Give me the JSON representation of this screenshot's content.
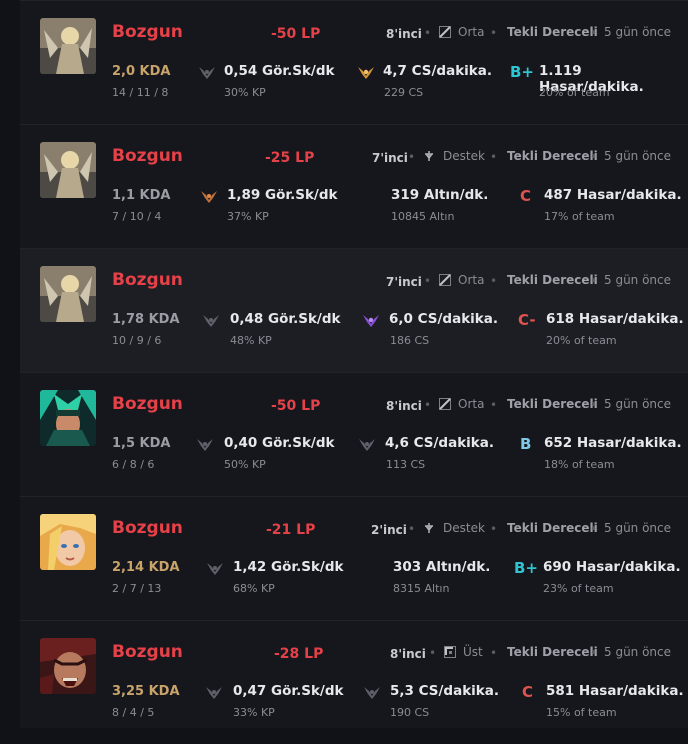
{
  "matches": [
    {
      "result": "Bozgun",
      "lp": "-50 LP",
      "rank": "8'inci",
      "position": "Orta",
      "queue": "Tekli Dereceli",
      "ago": "5 gün önce",
      "kda": "2,0 KDA",
      "kda_detail": "14 / 11 / 8",
      "vision": "0,54 Gör.Sk/dk",
      "kp": "30% KP",
      "farm": "4,7 CS/dakika.",
      "farm_sub": "229 CS",
      "grade": "B+",
      "damage": "1.119 Hasar/dakika.",
      "team_share": "20% of team",
      "kda_color": "#c8a36a",
      "grade_color": "#2fc4d0",
      "champion": "kayle-icon",
      "ward": "gold-ward-icon"
    },
    {
      "result": "Bozgun",
      "lp": "-25 LP",
      "rank": "7'inci",
      "position": "Destek",
      "queue": "Tekli Dereceli",
      "ago": "5 gün önce",
      "kda": "1,1 KDA",
      "kda_detail": "7 / 10 / 4",
      "vision": "1,89 Gör.Sk/dk",
      "kp": "37% KP",
      "farm": "319 Altın/dk.",
      "farm_sub": "10845 Altın",
      "grade": "C",
      "damage": "487 Hasar/dakika.",
      "team_share": "17% of team",
      "kda_color": "#9b9ca4",
      "grade_color": "#e0544f",
      "champion": "kayle-icon",
      "ward": "orange-ward-icon"
    },
    {
      "result": "Bozgun",
      "lp": "",
      "rank": "7'inci",
      "position": "Orta",
      "queue": "Tekli Dereceli",
      "ago": "5 gün önce",
      "kda": "1,78 KDA",
      "kda_detail": "10 / 9 / 6",
      "vision": "0,48 Gör.Sk/dk",
      "kp": "48% KP",
      "farm": "6,0 CS/dakika.",
      "farm_sub": "186 CS",
      "grade": "C-",
      "damage": "618 Hasar/dakika.",
      "team_share": "20% of team",
      "kda_color": "#9b9ca4",
      "grade_color": "#e0544f",
      "champion": "kayle-icon",
      "ward": "purple-ward-icon"
    },
    {
      "result": "Bozgun",
      "lp": "-50 LP",
      "rank": "8'inci",
      "position": "Orta",
      "queue": "Tekli Dereceli",
      "ago": "5 gün önce",
      "kda": "1,5 KDA",
      "kda_detail": "6 / 8 / 6",
      "vision": "0,40 Gör.Sk/dk",
      "kp": "50% KP",
      "farm": "4,6 CS/dakika.",
      "farm_sub": "113 CS",
      "grade": "B",
      "damage": "652 Hasar/dakika.",
      "team_share": "18% of team",
      "kda_color": "#9b9ca4",
      "grade_color": "#7fc8e8",
      "champion": "karma-icon",
      "ward": "gray-ward-icon"
    },
    {
      "result": "Bozgun",
      "lp": "-21 LP",
      "rank": "2'inci",
      "position": "Destek",
      "queue": "Tekli Dereceli",
      "ago": "5 gün önce",
      "kda": "2,14 KDA",
      "kda_detail": "2 / 7 / 13",
      "vision": "1,42 Gör.Sk/dk",
      "kp": "68% KP",
      "farm": "303 Altın/dk.",
      "farm_sub": "8315 Altın",
      "grade": "B+",
      "damage": "690 Hasar/dakika.",
      "team_share": "23% of team",
      "kda_color": "#c8a36a",
      "grade_color": "#2fc4d0",
      "champion": "lux-icon",
      "ward": "gray-ward-icon"
    },
    {
      "result": "Bozgun",
      "lp": "-28 LP",
      "rank": "8'inci",
      "position": "Üst",
      "queue": "Tekli Dereceli",
      "ago": "5 gün önce",
      "kda": "3,25 KDA",
      "kda_detail": "8 / 4 / 5",
      "vision": "0,47 Gör.Sk/dk",
      "kp": "33% KP",
      "farm": "5,3 CS/dakika.",
      "farm_sub": "190 CS",
      "grade": "C",
      "damage": "581 Hasar/dakika.",
      "team_share": "15% of team",
      "kda_color": "#c8a36a",
      "grade_color": "#e0544f",
      "champion": "darius-icon",
      "ward": "gray-ward-icon"
    }
  ]
}
